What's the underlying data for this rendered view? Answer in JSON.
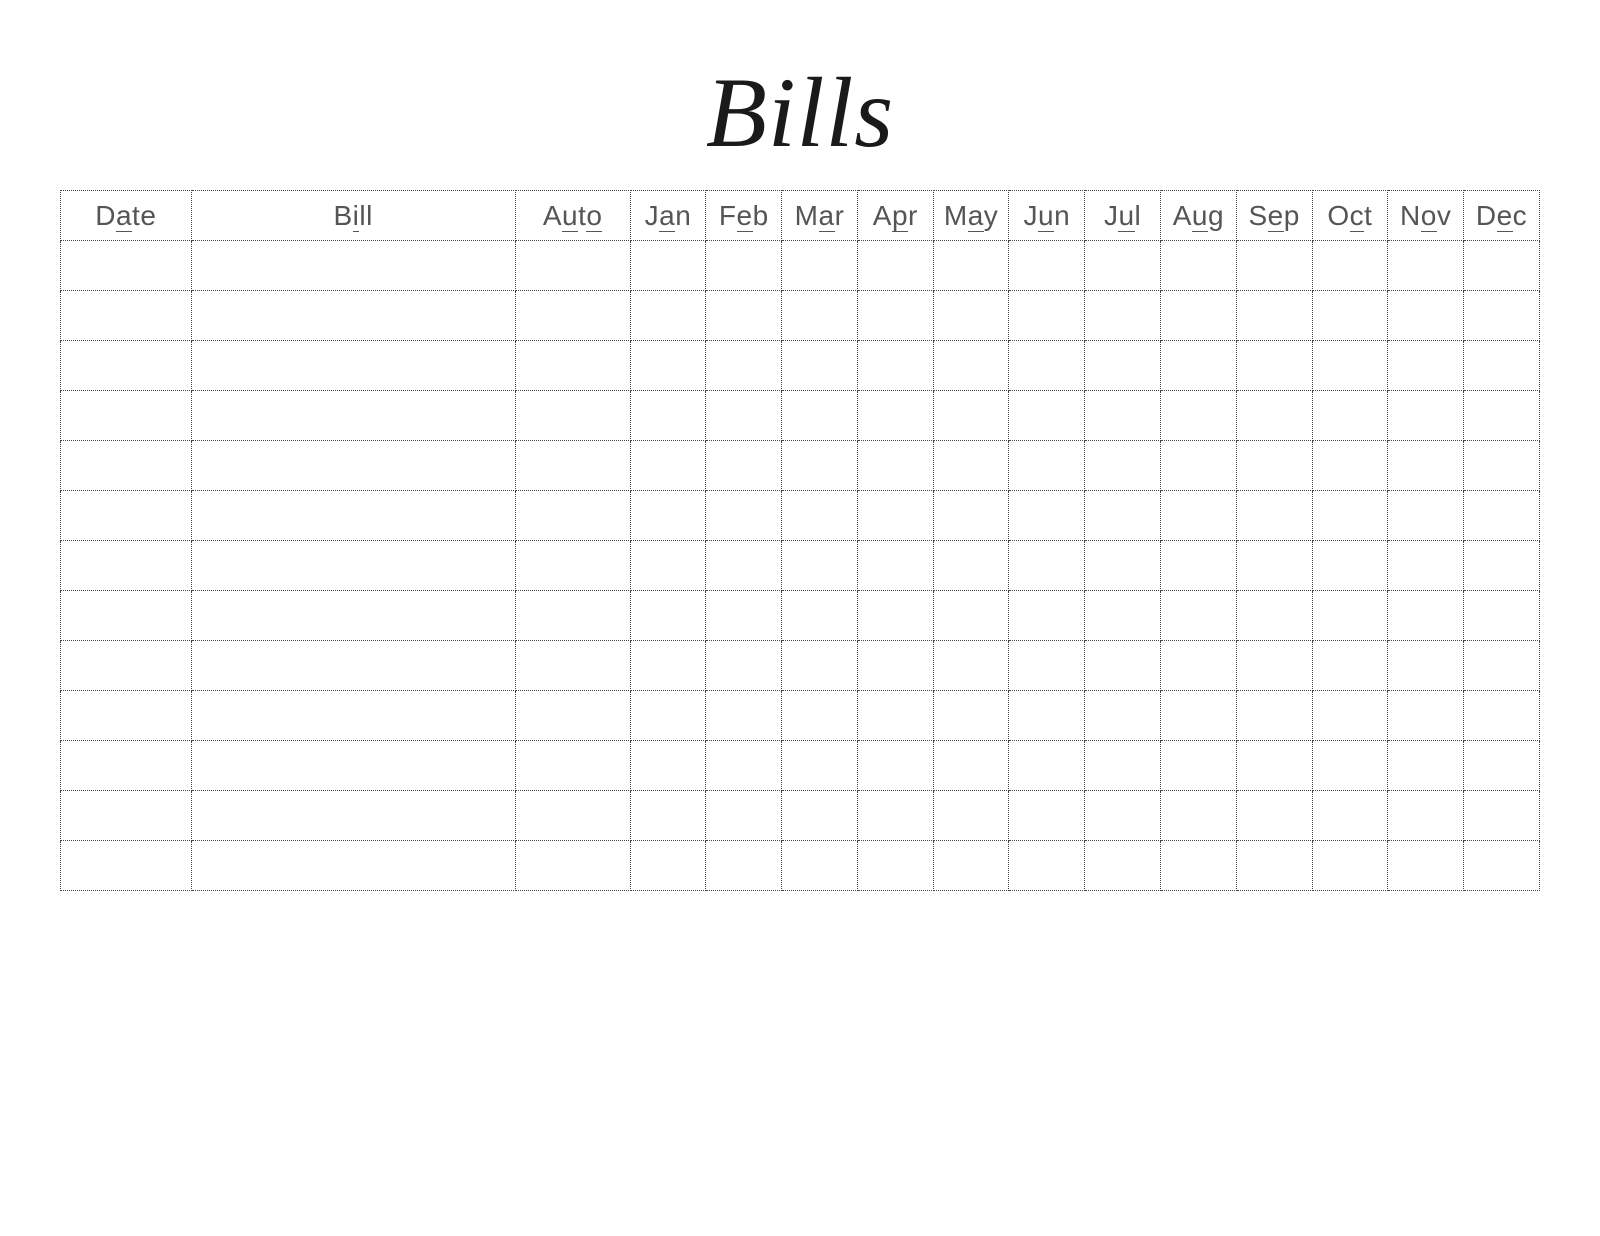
{
  "title": "Bills",
  "columns": {
    "date": "Date",
    "bill": "Bill",
    "auto": "Auto",
    "months": [
      "Jan",
      "Feb",
      "Mar",
      "Apr",
      "May",
      "Jun",
      "Jul",
      "Aug",
      "Sep",
      "Oct",
      "Nov",
      "Dec"
    ]
  },
  "row_count": 13
}
